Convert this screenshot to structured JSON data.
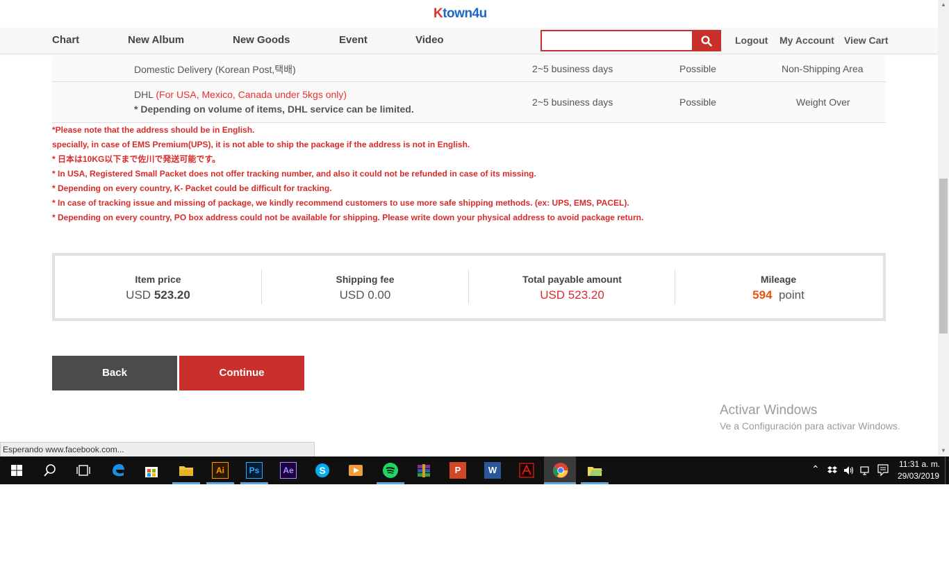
{
  "logo": {
    "k": "K",
    "rest": "town4u"
  },
  "nav": {
    "items": [
      "Chart",
      "New Album",
      "New Goods",
      "Event",
      "Video"
    ],
    "search_placeholder": "",
    "account": {
      "logout": "Logout",
      "my_account": "My Account",
      "view_cart": "View Cart"
    }
  },
  "shipping_rows": [
    {
      "method": "Domestic Delivery (Korean Post,택배)",
      "days": "2~5 business days",
      "availability": "Possible",
      "note": "Non-Shipping Area"
    },
    {
      "method": "DHL",
      "method_red": " (For USA, Mexico, Canada under 5kgs only)",
      "method_warning": "* Depending on volume of items, DHL service can be limited.",
      "days": "2~5 business days",
      "availability": "Possible",
      "note": "Weight Over"
    }
  ],
  "notes": [
    "*Please note that the address should be in English.",
    "specially, in case of EMS Premium(UPS), it is not able to ship the package if the address is not in English.",
    "* 日本は10KG以下まで佐川で発送可能です。",
    "* In USA, Registered Small Packet does not offer tracking number, and also it could not be refunded in case of its missing.",
    "* Depending on every country, K- Packet could be difficult for tracking.",
    "* In case of tracking issue and missing of package, we kindly recommend customers to use more safe shipping methods. (ex: UPS, EMS, PACEL).",
    "* Depending on every country, PO box address could not be available for shipping. Please write down your physical address to avoid package return."
  ],
  "summary": {
    "item_price": {
      "label": "Item price",
      "currency": "USD",
      "value": "523.20"
    },
    "shipping_fee": {
      "label": "Shipping fee",
      "value": "USD 0.00"
    },
    "total": {
      "label": "Total payable amount",
      "value": "USD 523.20"
    },
    "mileage": {
      "label": "Mileage",
      "points": "594",
      "unit": "point"
    }
  },
  "buttons": {
    "back": "Back",
    "continue": "Continue"
  },
  "watermark": {
    "title": "Activar Windows",
    "subtitle": "Ve a Configuración para activar Windows."
  },
  "status_bar": "Esperando www.facebook.com...",
  "taskbar": {
    "icons": [
      "windows-start-icon",
      "search-icon",
      "task-view-icon",
      "edge-icon",
      "store-icon",
      "file-explorer-icon",
      "illustrator-icon",
      "photoshop-icon",
      "after-effects-icon",
      "skype-icon",
      "media-player-icon",
      "spotify-icon",
      "winrar-icon",
      "powerpoint-icon",
      "word-icon",
      "acrobat-icon",
      "chrome-icon",
      "folder-app-icon"
    ],
    "app_labels": {
      "ai": "Ai",
      "ps": "Ps",
      "ae": "Ae",
      "word": "W",
      "ppt": "P"
    },
    "time": "11:31 a. m.",
    "date": "29/03/2019"
  },
  "colors": {
    "accent": "#c9302c",
    "back_button": "#4b4b4b",
    "notice_red": "#d82b2b"
  }
}
